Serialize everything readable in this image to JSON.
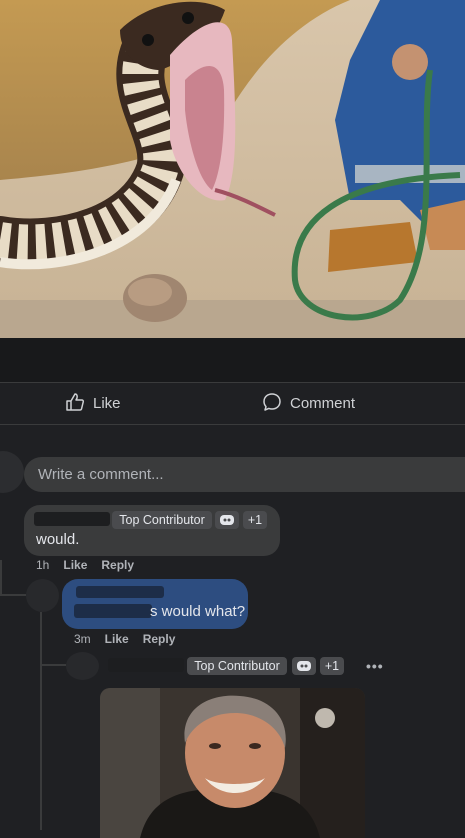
{
  "post": {
    "image_alt_icon": "photo-snake-and-worker"
  },
  "actions": {
    "like_label": "Like",
    "comment_label": "Comment",
    "like_icon": "thumbs-up-icon",
    "comment_icon": "speech-bubble-icon"
  },
  "composer": {
    "placeholder": "Write a comment..."
  },
  "comments": [
    {
      "badge": "Top Contributor",
      "badge_icon": "emoji-icon",
      "count": "+1",
      "text": "would.",
      "time": "1h",
      "like": "Like",
      "reply": "Reply"
    },
    {
      "text": "s would what?",
      "time": "3m",
      "like": "Like",
      "reply": "Reply"
    },
    {
      "badge": "Top Contributor",
      "count": "+1",
      "more": "•••"
    }
  ],
  "colors": {
    "background": "#1f2023",
    "bubble": "#3a3b3c",
    "own_bubble": "#2d4d80"
  }
}
